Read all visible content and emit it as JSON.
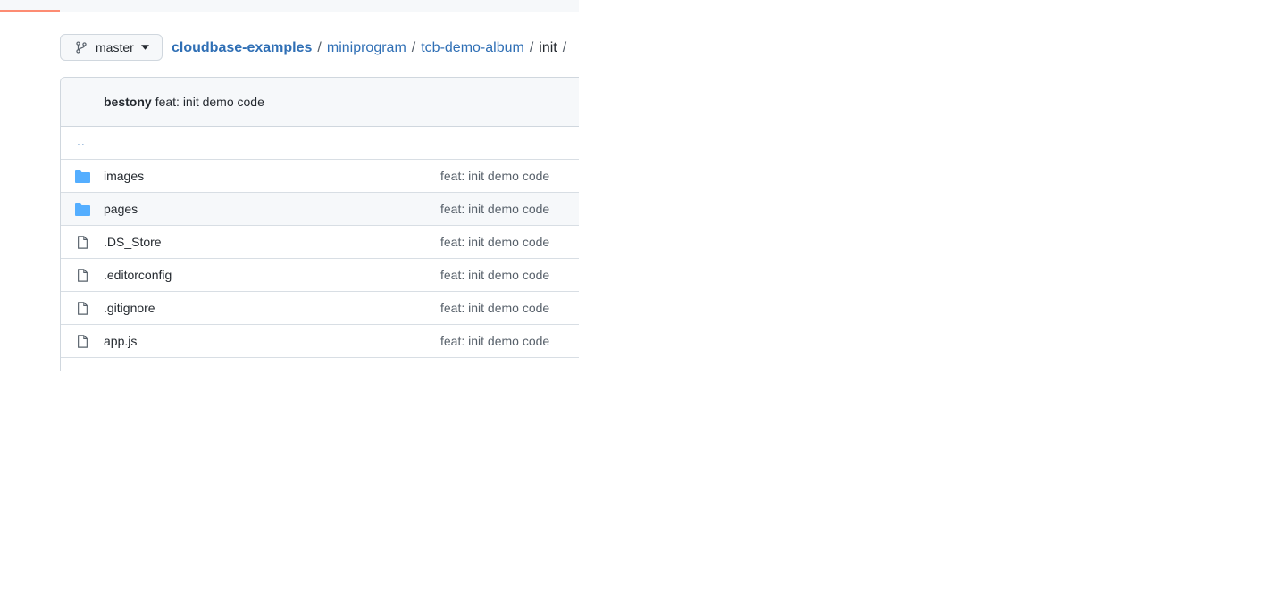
{
  "branch": {
    "label": "master"
  },
  "breadcrumb": {
    "repo": "cloudbase-examples",
    "path": [
      "miniprogram",
      "tcb-demo-album"
    ],
    "current": "init",
    "separator": "/"
  },
  "commit": {
    "author": "bestony",
    "message": "feat: init demo code"
  },
  "parent_dir": "..",
  "files": [
    {
      "name": "images",
      "type": "folder-icon",
      "message": "feat: init demo code"
    },
    {
      "name": "pages",
      "type": "folder-icon",
      "message": "feat: init demo code"
    },
    {
      "name": ".DS_Store",
      "type": "file-icon",
      "message": "feat: init demo code"
    },
    {
      "name": ".editorconfig",
      "type": "file-icon",
      "message": "feat: init demo code"
    },
    {
      "name": ".gitignore",
      "type": "file-icon",
      "message": "feat: init demo code"
    },
    {
      "name": "app.js",
      "type": "file-icon",
      "message": "feat: init demo code"
    }
  ],
  "colors": {
    "link": "#2f6fb5",
    "folder": "#54aeff",
    "tab_underline": "#fd8c73"
  }
}
